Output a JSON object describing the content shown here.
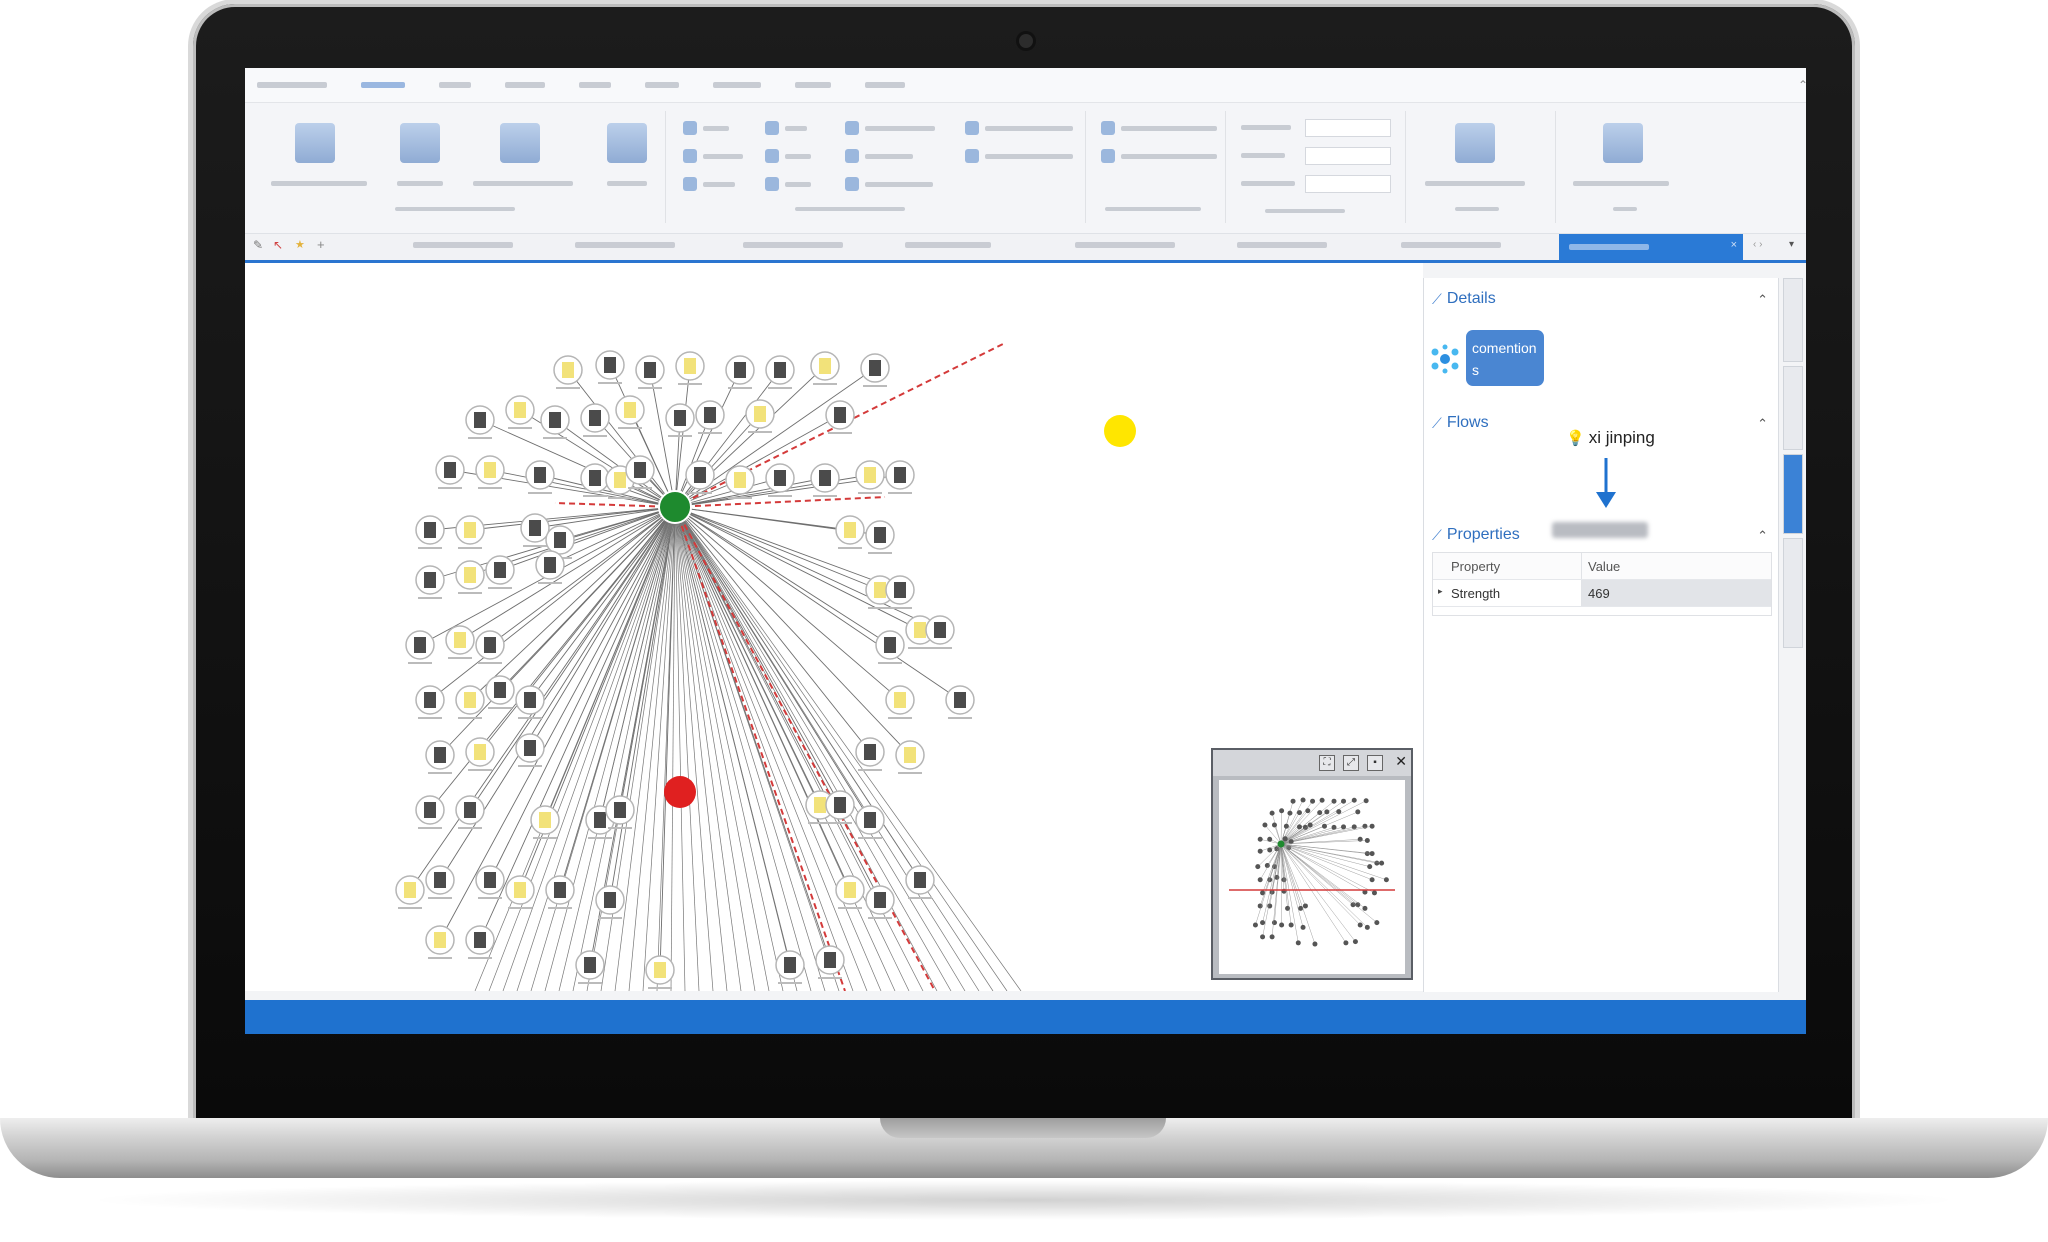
{
  "panel": {
    "details": {
      "title": "Details",
      "node_label": "comentions"
    },
    "flows": {
      "title": "Flows",
      "from": "xi jinping"
    },
    "properties": {
      "title": "Properties",
      "columns": [
        "Property",
        "Value"
      ],
      "rows": [
        {
          "property": "Strength",
          "value": "469"
        }
      ]
    }
  },
  "colors": {
    "accent": "#2a75d0",
    "hub_node": "#1e8a2e",
    "alert_node": "#e02020",
    "highlight_node": "#ffe600",
    "strong_edge": "#d43a3a"
  }
}
